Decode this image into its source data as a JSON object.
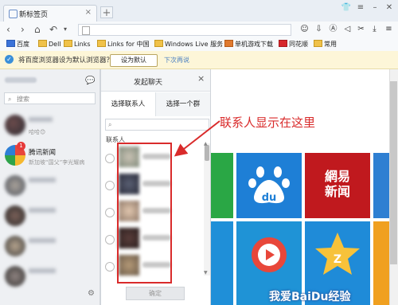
{
  "browser": {
    "tab_title": "新标签页",
    "tab_close": "×",
    "new_tab": "+",
    "nav": {
      "back": "‹",
      "forward": "›",
      "undo": "↶",
      "url_value": ""
    },
    "toolbar_icons": [
      "chat-icon",
      "download-icon",
      "adblock-icon",
      "mute-icon",
      "cut-icon",
      "save-icon",
      "menu-icon"
    ],
    "bookmarks": [
      {
        "label": "百度"
      },
      {
        "label": "Dell"
      },
      {
        "label": "Links"
      },
      {
        "label": "Links for 中国"
      },
      {
        "label": "Windows Live 服务"
      },
      {
        "label": "单机游戏下载"
      },
      {
        "label": "同花顺"
      },
      {
        "label": "常用"
      }
    ],
    "infobar": {
      "text": "将百度浏览器设为默认浏览器？",
      "set_default": "设为默认",
      "later": "下次再说"
    }
  },
  "qq_main": {
    "search_placeholder": "搜索",
    "contacts": [
      {
        "name": "",
        "sub": "哈哈😊"
      },
      {
        "name": "腾讯新闻",
        "sub": "新加坡“国父”李光耀病",
        "badge": "1"
      },
      {
        "name": "",
        "sub": ""
      },
      {
        "name": "",
        "sub": ""
      },
      {
        "name": "",
        "sub": ""
      },
      {
        "name": "",
        "sub": ""
      }
    ]
  },
  "dialog": {
    "title": "发起聊天",
    "close": "×",
    "tab_contacts": "选择联系人",
    "tab_group": "选择一个群",
    "section_label": "联系人",
    "ok_button": "确定"
  },
  "annotation": {
    "text": "联系人显示在这里",
    "color": "#d92b2b"
  },
  "watermark": "我爱BaiDu经验",
  "tiles": [
    {
      "name": "baidu-tile",
      "label": "du",
      "color": "#1e7fd6"
    },
    {
      "name": "netease-news-tile",
      "label": "網易\n新闻",
      "color": "#c0191e"
    }
  ]
}
